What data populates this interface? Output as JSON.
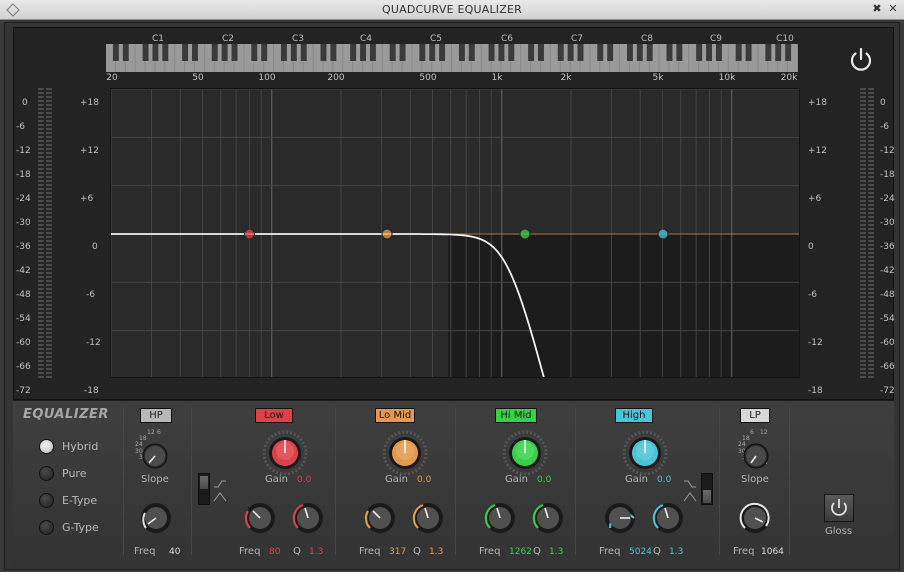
{
  "window": {
    "title": "QUADCURVE EQUALIZER",
    "pin_icon": "pin-icon",
    "close_icon": "close-icon"
  },
  "display": {
    "octaves": [
      "C1",
      "C2",
      "C3",
      "C4",
      "C5",
      "C6",
      "C7",
      "C8",
      "C9",
      "C10"
    ],
    "freq_ticks": [
      "20",
      "50",
      "100",
      "200",
      "500",
      "1k",
      "2k",
      "5k",
      "10k",
      "20k"
    ],
    "gain_scale": [
      "+18",
      "+12",
      "+6",
      "0",
      "-6",
      "-12",
      "-18"
    ],
    "meter_scale": [
      "0",
      "-6",
      "-12",
      "-18",
      "-24",
      "-30",
      "-36",
      "-42",
      "-48",
      "-54",
      "-60",
      "-66",
      "-72"
    ]
  },
  "panel": {
    "title": "EQUALIZER",
    "modes": [
      {
        "label": "Hybrid",
        "selected": true
      },
      {
        "label": "Pure",
        "selected": false
      },
      {
        "label": "E-Type",
        "selected": false
      },
      {
        "label": "G-Type",
        "selected": false
      }
    ],
    "hp": {
      "label": "HP",
      "slope_label": "Slope",
      "slope_scale": [
        "12",
        "6",
        "18",
        "24",
        "30",
        "36",
        "42",
        "48"
      ],
      "freq_label": "Freq",
      "freq_value": "40"
    },
    "bands": [
      {
        "name": "Low",
        "color": "#e0404a",
        "gain_label": "Gain",
        "gain": "0.0",
        "freq_label": "Freq",
        "freq": "80",
        "q_label": "Q",
        "q": "1.3"
      },
      {
        "name": "Lo Mid",
        "color": "#e39a4c",
        "gain_label": "Gain",
        "gain": "0.0",
        "freq_label": "Freq",
        "freq": "317",
        "q_label": "Q",
        "q": "1.3"
      },
      {
        "name": "Hi Mid",
        "color": "#37d24a",
        "gain_label": "Gain",
        "gain": "0.0",
        "freq_label": "Freq",
        "freq": "1262",
        "q_label": "Q",
        "q": "1.3"
      },
      {
        "name": "High",
        "color": "#4cc3d6",
        "gain_label": "Gain",
        "gain": "0.0",
        "freq_label": "Freq",
        "freq": "5024",
        "q_label": "Q",
        "q": "1.3"
      }
    ],
    "gain_scale": [
      "0",
      "3",
      "3",
      "9",
      "9",
      "18",
      "18"
    ],
    "lp": {
      "label": "LP",
      "slope_label": "Slope",
      "slope_scale": [
        "6",
        "12",
        "18",
        "24",
        "30",
        "36",
        "42",
        "48"
      ],
      "freq_label": "Freq",
      "freq_value": "1064"
    },
    "gloss": {
      "label": "Gloss"
    }
  }
}
